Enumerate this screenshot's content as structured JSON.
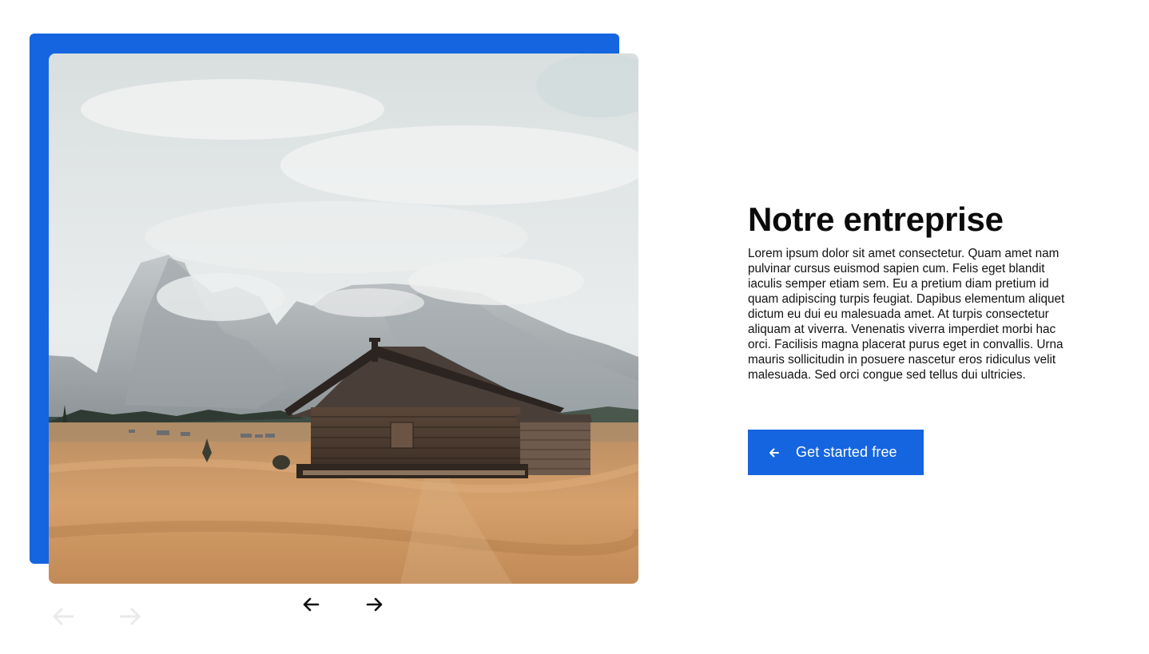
{
  "hero": {
    "image_alt": "Wooden cabin in a dry meadow in front of cloud-covered mountains",
    "accent_color": "#1565e0"
  },
  "carousel": {
    "prev_icon": "arrow-left-icon",
    "next_icon": "arrow-right-icon"
  },
  "section": {
    "title": "Notre entreprise",
    "body": "Lorem ipsum dolor sit amet consectetur. Quam amet nam pulvinar cursus euismod sapien cum. Felis eget blandit iaculis semper etiam sem. Eu a pretium diam pretium id quam adipiscing turpis feugiat. Dapibus elementum aliquet dictum eu dui eu malesuada amet. At turpis consectetur aliquam at viverra. Venenatis viverra imperdiet morbi hac orci. Facilisis magna placerat purus eget in convallis. Urna mauris sollicitudin in posuere nascetur eros ridiculus velit malesuada. Sed orci congue sed tellus dui ultricies."
  },
  "cta": {
    "label": "Get started free",
    "icon": "arrow-left-icon",
    "color": "#1565e0"
  }
}
